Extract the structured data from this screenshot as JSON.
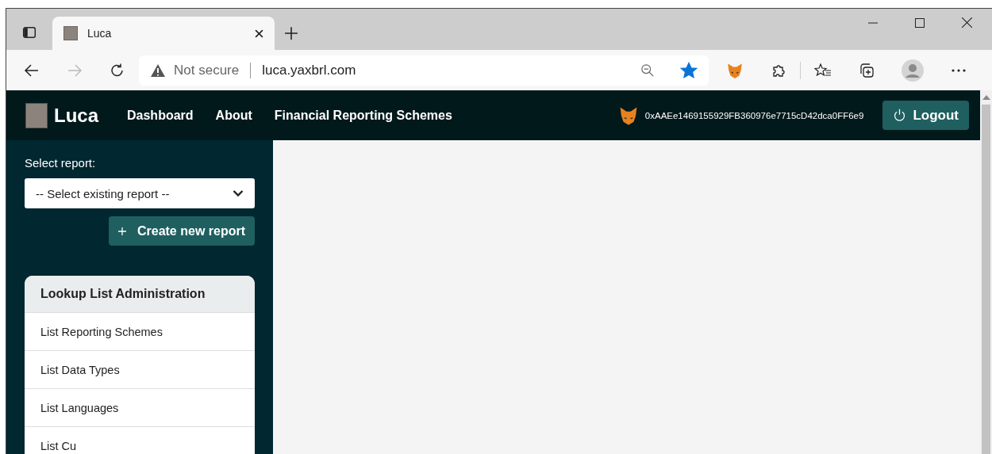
{
  "browser": {
    "tab_title": "Luca",
    "security_label": "Not secure",
    "url": "luca.yaxbrl.com",
    "favorite_starred": true
  },
  "navbar": {
    "brand": "Luca",
    "links": [
      {
        "label": "Dashboard"
      },
      {
        "label": "About"
      },
      {
        "label": "Financial Reporting Schemes"
      }
    ],
    "account": "0xAAEe1469155929FB360976e7715cD42dca0FF6e9",
    "logout": "Logout"
  },
  "sidebar": {
    "select_label": "Select report:",
    "select_placeholder": "-- Select existing report --",
    "create_button": "Create new report",
    "panel": {
      "title": "Lookup List Administration",
      "items": [
        {
          "label": "List Reporting Schemes"
        },
        {
          "label": "List Data Types"
        },
        {
          "label": "List Languages"
        },
        {
          "label": "List Cu"
        }
      ]
    }
  }
}
